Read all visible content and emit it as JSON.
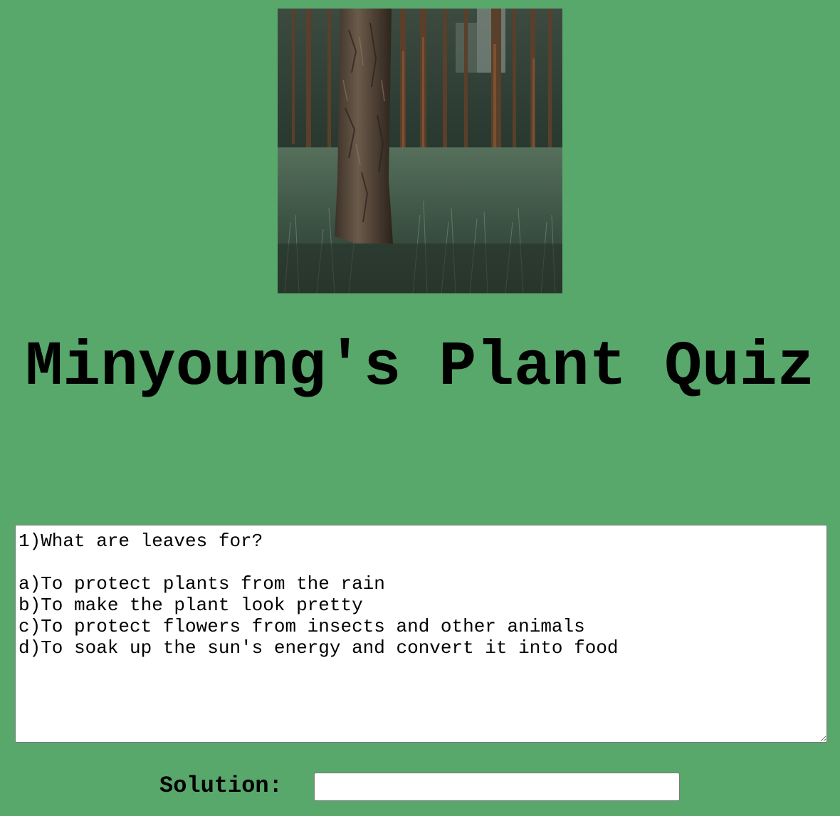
{
  "page": {
    "background_color": "#58a76b"
  },
  "hero_image": {
    "description_icon": "forest-photo",
    "alt": "pine forest"
  },
  "title": "Minyoung's Plant Quiz",
  "question_box": {
    "value": "1)What are leaves for?\n\na)To protect plants from the rain\nb)To make the plant look pretty\nc)To protect flowers from insects and other animals\nd)To soak up the sun's energy and convert it into food"
  },
  "solution": {
    "label": "Solution:",
    "value": "",
    "placeholder": ""
  }
}
